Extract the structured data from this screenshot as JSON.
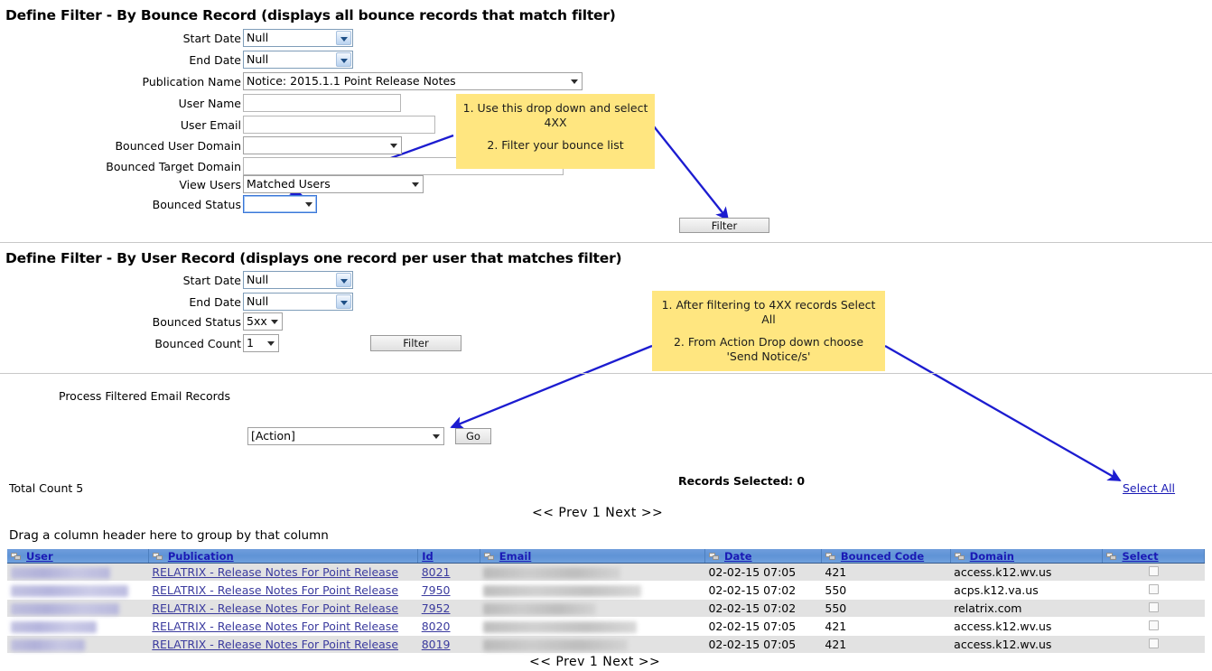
{
  "bounce_filter": {
    "title": "Define Filter - By Bounce Record (displays all bounce records that match filter)",
    "labels": {
      "start_date": "Start Date",
      "end_date": "End Date",
      "publication_name": "Publication Name",
      "user_name": "User Name",
      "user_email": "User Email",
      "bounced_user_domain": "Bounced User Domain",
      "bounced_target_domain": "Bounced Target Domain",
      "view_users": "View Users",
      "bounced_status": "Bounced Status"
    },
    "values": {
      "start_date": "Null",
      "end_date": "Null",
      "publication_name": "Notice: 2015.1.1 Point Release Notes",
      "user_name": "",
      "user_email": "",
      "bounced_user_domain": "",
      "bounced_target_domain": "",
      "view_users": "Matched Users",
      "bounced_status": ""
    },
    "filter_button": "Filter"
  },
  "user_filter": {
    "title": "Define Filter - By User Record (displays one record per user that matches filter)",
    "labels": {
      "start_date": "Start Date",
      "end_date": "End Date",
      "bounced_status": "Bounced Status",
      "bounced_count": "Bounced Count"
    },
    "values": {
      "start_date": "Null",
      "end_date": "Null",
      "bounced_status": "5xx",
      "bounced_count": "1"
    },
    "filter_button": "Filter"
  },
  "process": {
    "heading": "Process Filtered Email Records",
    "action_value": "[Action]",
    "go_button": "Go"
  },
  "callouts": {
    "one": {
      "line1": "1. Use this drop down and",
      "line2": "select 4XX",
      "line3": "2. Filter your bounce list"
    },
    "two": {
      "line1": "1. After filtering to 4XX records",
      "line2": "Select All",
      "line3": "2. From Action Drop down",
      "line4": "choose 'Send Notice/s'"
    }
  },
  "summary": {
    "total_count": "Total Count 5",
    "records_selected": "Records Selected: 0",
    "select_all": "Select All ",
    "pager_top": "<< Prev 1 Next >>",
    "pager_bottom": "<< Prev 1 Next >>",
    "group_hint": "Drag a column header here to group by that column"
  },
  "grid": {
    "columns": [
      "User",
      "Publication",
      "Id",
      "Email",
      "Date",
      "Bounced Code",
      "Domain",
      "Select"
    ],
    "rows": [
      {
        "user": "",
        "publication": "RELATRIX - Release Notes For Point Release",
        "id": "8021",
        "email": "",
        "date": "02-02-15 07:05",
        "bounced_code": "421",
        "domain": "access.k12.wv.us",
        "selected": false
      },
      {
        "user": "",
        "publication": "RELATRIX - Release Notes For Point Release",
        "id": "7950",
        "email": "",
        "date": "02-02-15 07:02",
        "bounced_code": "550",
        "domain": "acps.k12.va.us",
        "selected": false
      },
      {
        "user": "",
        "publication": "RELATRIX - Release Notes For Point Release",
        "id": "7952",
        "email": "",
        "date": "02-02-15 07:02",
        "bounced_code": "550",
        "domain": "relatrix.com",
        "selected": false
      },
      {
        "user": "",
        "publication": "RELATRIX - Release Notes For Point Release",
        "id": "8020",
        "email": "",
        "date": "02-02-15 07:05",
        "bounced_code": "421",
        "domain": "access.k12.wv.us",
        "selected": false
      },
      {
        "user": "",
        "publication": "RELATRIX - Release Notes For Point Release",
        "id": "8019",
        "email": "",
        "date": "02-02-15 07:05",
        "bounced_code": "421",
        "domain": "access.k12.wv.us",
        "selected": false
      }
    ]
  },
  "colors": {
    "callout_bg": "#ffe680",
    "arrow": "#1c1cd0",
    "grid_header": "#6f9ddc",
    "link": "#1a1ab5",
    "row_alt": "#e2e2e2"
  }
}
